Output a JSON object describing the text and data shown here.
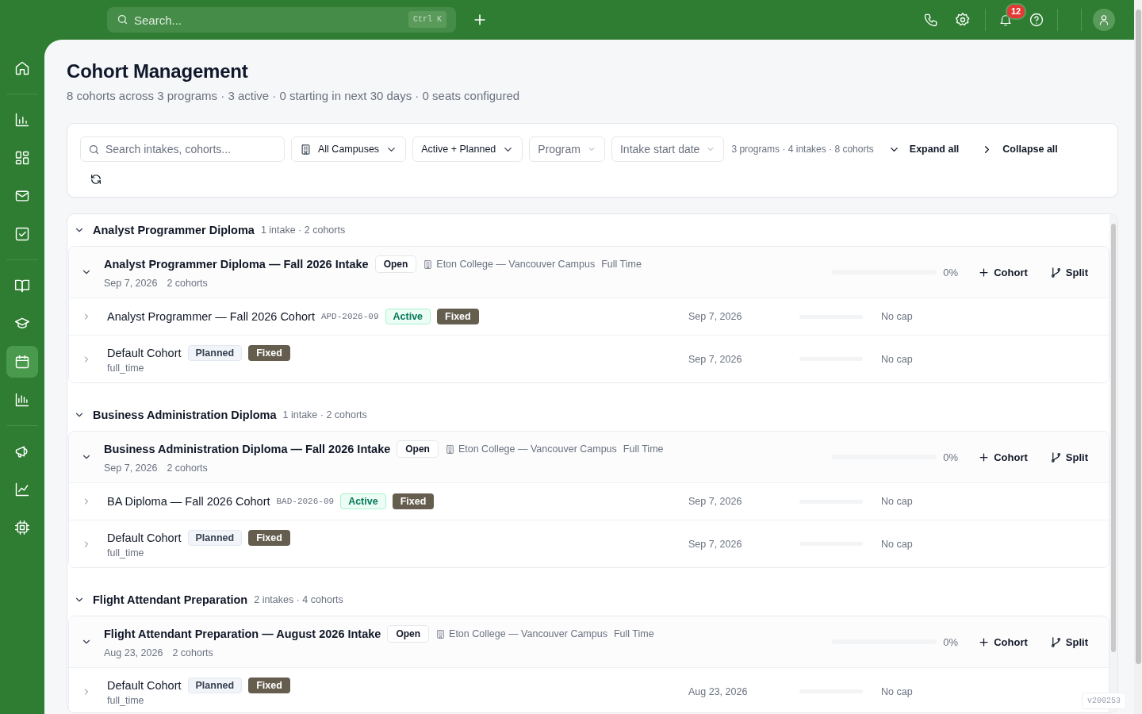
{
  "topbar": {
    "search": {
      "placeholder": "Search...",
      "shortcut": "Ctrl K"
    },
    "notifications": "12"
  },
  "sidebar": {
    "groups": [
      [
        {
          "selected": false
        }
      ],
      [
        {
          "selected": false
        },
        {
          "selected": false
        },
        {
          "selected": false
        },
        {
          "selected": false
        }
      ],
      [
        {
          "selected": false
        },
        {
          "selected": false
        },
        {
          "selected": true
        },
        {
          "selected": false
        }
      ],
      [
        {
          "selected": false
        },
        {
          "selected": false
        },
        {
          "selected": false
        }
      ]
    ]
  },
  "header": {
    "title": "Cohort Management",
    "subtitle": "8 cohorts across 3 programs · 3 active · 0 starting in next 30 days · 0 seats configured"
  },
  "filters": {
    "search": {
      "placeholder": "Search intakes, cohorts..."
    },
    "dropdowns": [
      {
        "kind": "campus",
        "label": "All Campuses"
      },
      {
        "kind": "value",
        "label": "Active + Planned"
      },
      {
        "kind": "placeholder",
        "label": "Program"
      },
      {
        "kind": "placeholder",
        "label": "Intake start date"
      }
    ],
    "summary": "3 programs · 4 intakes · 8 cohorts",
    "expand": "Expand all",
    "collapse": "Collapse all"
  },
  "programs": [
    {
      "name": "Analyst Programmer Diploma",
      "meta": "1 intake · 2 cohorts",
      "expanded": true,
      "intakes": [
        {
          "title": "Analyst Programmer Diploma — Fall 2026 Intake",
          "status": "Open",
          "campus": "Eton College — Vancouver Campus",
          "mode": "Full Time",
          "date": "Sep 7, 2026",
          "count": "2 cohorts",
          "level": 0,
          "percent": "0%",
          "add": "Cohort",
          "split": "Split",
          "expanded": true,
          "cohorts": [
            {
              "name": "Analyst Programmer — Fall 2026 Cohort",
              "code": "APD-2026-09",
              "status": {
                "label": "Active",
                "kind": "active"
              },
              "type": "Fixed",
              "date": "Sep 7, 2026",
              "level": 0,
              "cap": "No cap",
              "expanded": false
            },
            {
              "name": "Default Cohort",
              "status": {
                "label": "Planned",
                "kind": "planned"
              },
              "type": "Fixed",
              "sub": "full_time",
              "date": "Sep 7, 2026",
              "level": 0,
              "cap": "No cap",
              "expanded": false
            }
          ]
        }
      ]
    },
    {
      "name": "Business Administration Diploma",
      "meta": "1 intake · 2 cohorts",
      "expanded": true,
      "intakes": [
        {
          "title": "Business Administration Diploma — Fall 2026 Intake",
          "status": "Open",
          "campus": "Eton College — Vancouver Campus",
          "mode": "Full Time",
          "date": "Sep 7, 2026",
          "count": "2 cohorts",
          "level": 0,
          "percent": "0%",
          "add": "Cohort",
          "split": "Split",
          "expanded": true,
          "cohorts": [
            {
              "name": "BA Diploma — Fall 2026 Cohort",
              "code": "BAD-2026-09",
              "status": {
                "label": "Active",
                "kind": "active"
              },
              "type": "Fixed",
              "date": "Sep 7, 2026",
              "level": 0,
              "cap": "No cap",
              "expanded": false
            },
            {
              "name": "Default Cohort",
              "status": {
                "label": "Planned",
                "kind": "planned"
              },
              "type": "Fixed",
              "sub": "full_time",
              "date": "Sep 7, 2026",
              "level": 0,
              "cap": "No cap",
              "expanded": false
            }
          ]
        }
      ]
    },
    {
      "name": "Flight Attendant Preparation",
      "meta": "2 intakes · 4 cohorts",
      "expanded": true,
      "intakes": [
        {
          "title": "Flight Attendant Preparation — August 2026 Intake",
          "status": "Open",
          "campus": "Eton College — Vancouver Campus",
          "mode": "Full Time",
          "date": "Aug 23, 2026",
          "count": "2 cohorts",
          "level": 0,
          "percent": "0%",
          "add": "Cohort",
          "split": "Split",
          "expanded": true,
          "cohorts": [
            {
              "name": "Default Cohort",
              "status": {
                "label": "Planned",
                "kind": "planned"
              },
              "type": "Fixed",
              "sub": "full_time",
              "date": "Aug 23, 2026",
              "level": 0,
              "cap": "No cap",
              "expanded": false
            }
          ]
        }
      ]
    }
  ],
  "version": "v200253"
}
